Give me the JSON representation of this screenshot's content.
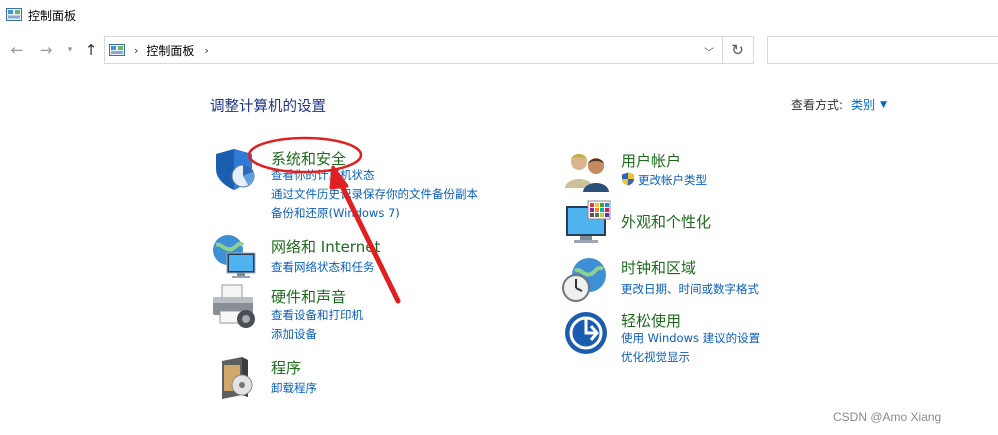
{
  "window": {
    "title": "控制面板"
  },
  "nav": {
    "back_icon": "arrow-left-icon",
    "forward_icon": "arrow-right-icon",
    "recent_icon": "chevron-down-icon",
    "up_icon": "arrow-up-icon",
    "breadcrumb": "控制面板",
    "refresh_icon": "refresh-icon"
  },
  "main": {
    "heading": "调整计算机的设置",
    "view_mode": {
      "label": "查看方式:",
      "value": "类别"
    }
  },
  "categories_left": [
    {
      "title": "系统和安全",
      "links": [
        "查看你的计算机状态",
        "通过文件历史记录保存你的文件备份副本",
        "备份和还原(Windows 7)"
      ]
    },
    {
      "title": "网络和 Internet",
      "links": [
        "查看网络状态和任务"
      ]
    },
    {
      "title": "硬件和声音",
      "links": [
        "查看设备和打印机",
        "添加设备"
      ]
    },
    {
      "title": "程序",
      "links": [
        "卸载程序"
      ]
    }
  ],
  "categories_right": [
    {
      "title": "用户帐户",
      "links": [
        "更改帐户类型"
      ]
    },
    {
      "title": "外观和个性化",
      "links": []
    },
    {
      "title": "时钟和区域",
      "links": [
        "更改日期、时间或数字格式"
      ]
    },
    {
      "title": "轻松使用",
      "links": [
        "使用 Windows 建议的设置",
        "优化视觉显示"
      ]
    }
  ],
  "annotation": {
    "color": "#e02020"
  },
  "watermark": "CSDN @Amo Xiang"
}
